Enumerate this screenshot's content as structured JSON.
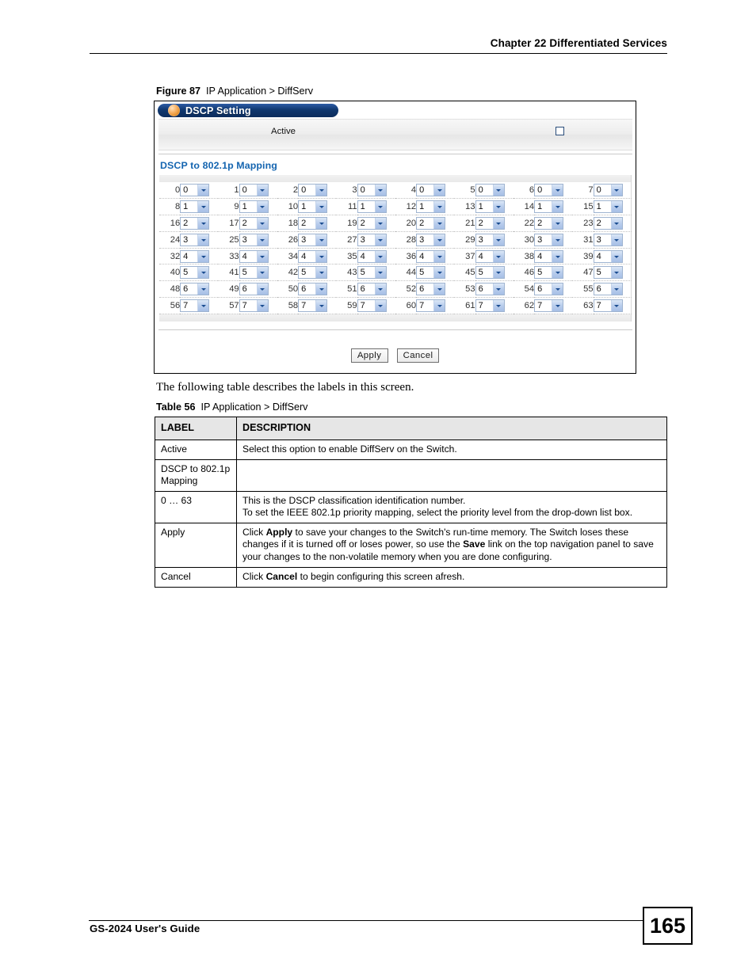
{
  "page": {
    "running_header": "Chapter 22 Differentiated Services",
    "footer_text": "GS-2024 User's Guide",
    "page_number": "165"
  },
  "figure": {
    "caption_number": "Figure 87",
    "caption_title": "IP Application > DiffServ",
    "panel_title": "DSCP Setting",
    "panel_icon": "orange-ball-icon",
    "active_label": "Active",
    "active_checked": false,
    "section_heading": "DSCP to 802.1p Mapping",
    "buttons": {
      "apply": "Apply",
      "cancel": "Cancel"
    },
    "dscp_options": [
      "0",
      "1",
      "2",
      "3",
      "4",
      "5",
      "6",
      "7"
    ],
    "dscp_rows": [
      [
        {
          "id": "0",
          "value": "0"
        },
        {
          "id": "1",
          "value": "0"
        },
        {
          "id": "2",
          "value": "0"
        },
        {
          "id": "3",
          "value": "0"
        },
        {
          "id": "4",
          "value": "0"
        },
        {
          "id": "5",
          "value": "0"
        },
        {
          "id": "6",
          "value": "0"
        },
        {
          "id": "7",
          "value": "0"
        }
      ],
      [
        {
          "id": "8",
          "value": "1"
        },
        {
          "id": "9",
          "value": "1"
        },
        {
          "id": "10",
          "value": "1"
        },
        {
          "id": "11",
          "value": "1"
        },
        {
          "id": "12",
          "value": "1"
        },
        {
          "id": "13",
          "value": "1"
        },
        {
          "id": "14",
          "value": "1"
        },
        {
          "id": "15",
          "value": "1"
        }
      ],
      [
        {
          "id": "16",
          "value": "2"
        },
        {
          "id": "17",
          "value": "2"
        },
        {
          "id": "18",
          "value": "2"
        },
        {
          "id": "19",
          "value": "2"
        },
        {
          "id": "20",
          "value": "2"
        },
        {
          "id": "21",
          "value": "2"
        },
        {
          "id": "22",
          "value": "2"
        },
        {
          "id": "23",
          "value": "2"
        }
      ],
      [
        {
          "id": "24",
          "value": "3"
        },
        {
          "id": "25",
          "value": "3"
        },
        {
          "id": "26",
          "value": "3"
        },
        {
          "id": "27",
          "value": "3"
        },
        {
          "id": "28",
          "value": "3"
        },
        {
          "id": "29",
          "value": "3"
        },
        {
          "id": "30",
          "value": "3"
        },
        {
          "id": "31",
          "value": "3"
        }
      ],
      [
        {
          "id": "32",
          "value": "4"
        },
        {
          "id": "33",
          "value": "4"
        },
        {
          "id": "34",
          "value": "4"
        },
        {
          "id": "35",
          "value": "4"
        },
        {
          "id": "36",
          "value": "4"
        },
        {
          "id": "37",
          "value": "4"
        },
        {
          "id": "38",
          "value": "4"
        },
        {
          "id": "39",
          "value": "4"
        }
      ],
      [
        {
          "id": "40",
          "value": "5"
        },
        {
          "id": "41",
          "value": "5"
        },
        {
          "id": "42",
          "value": "5"
        },
        {
          "id": "43",
          "value": "5"
        },
        {
          "id": "44",
          "value": "5"
        },
        {
          "id": "45",
          "value": "5"
        },
        {
          "id": "46",
          "value": "5"
        },
        {
          "id": "47",
          "value": "5"
        }
      ],
      [
        {
          "id": "48",
          "value": "6"
        },
        {
          "id": "49",
          "value": "6"
        },
        {
          "id": "50",
          "value": "6"
        },
        {
          "id": "51",
          "value": "6"
        },
        {
          "id": "52",
          "value": "6"
        },
        {
          "id": "53",
          "value": "6"
        },
        {
          "id": "54",
          "value": "6"
        },
        {
          "id": "55",
          "value": "6"
        }
      ],
      [
        {
          "id": "56",
          "value": "7"
        },
        {
          "id": "57",
          "value": "7"
        },
        {
          "id": "58",
          "value": "7"
        },
        {
          "id": "59",
          "value": "7"
        },
        {
          "id": "60",
          "value": "7"
        },
        {
          "id": "61",
          "value": "7"
        },
        {
          "id": "62",
          "value": "7"
        },
        {
          "id": "63",
          "value": "7"
        }
      ]
    ]
  },
  "intro_sentence": "The following table describes the labels in this screen.",
  "table": {
    "caption_number": "Table 56",
    "caption_title": "IP Application > DiffServ",
    "headers": [
      "LABEL",
      "DESCRIPTION"
    ],
    "rows": [
      {
        "label": "Active",
        "description_parts": [
          {
            "text": "Select this option to enable DiffServ on the Switch.",
            "bold": false
          }
        ]
      },
      {
        "label": "DSCP to 802.1p Mapping",
        "description_parts": []
      },
      {
        "label": "0 … 63",
        "description_parts": [
          {
            "text": "This is the DSCP classification identification number.",
            "bold": false
          },
          {
            "text": "\n",
            "bold": false
          },
          {
            "text": "To set the IEEE 802.1p priority mapping, select the priority level from the drop-down list box.",
            "bold": false
          }
        ]
      },
      {
        "label": "Apply",
        "description_parts": [
          {
            "text": "Click ",
            "bold": false
          },
          {
            "text": "Apply",
            "bold": true
          },
          {
            "text": " to save your changes to the Switch's run-time memory. The Switch loses these changes if it is turned off or loses power, so use the ",
            "bold": false
          },
          {
            "text": "Save",
            "bold": true
          },
          {
            "text": " link on the top navigation panel to save your changes to the non-volatile memory when you are done configuring.",
            "bold": false
          }
        ]
      },
      {
        "label": "Cancel",
        "description_parts": [
          {
            "text": "Click ",
            "bold": false
          },
          {
            "text": "Cancel",
            "bold": true
          },
          {
            "text": " to begin configuring this screen afresh.",
            "bold": false
          }
        ]
      }
    ]
  },
  "colors": {
    "panel_title_blue": "#0c2c5c",
    "section_heading_blue": "#1565b0",
    "ball_orange": "#e08a24",
    "table_header_gray": "#e6e6e6",
    "select_arrow_blue": "#b9cdec"
  }
}
